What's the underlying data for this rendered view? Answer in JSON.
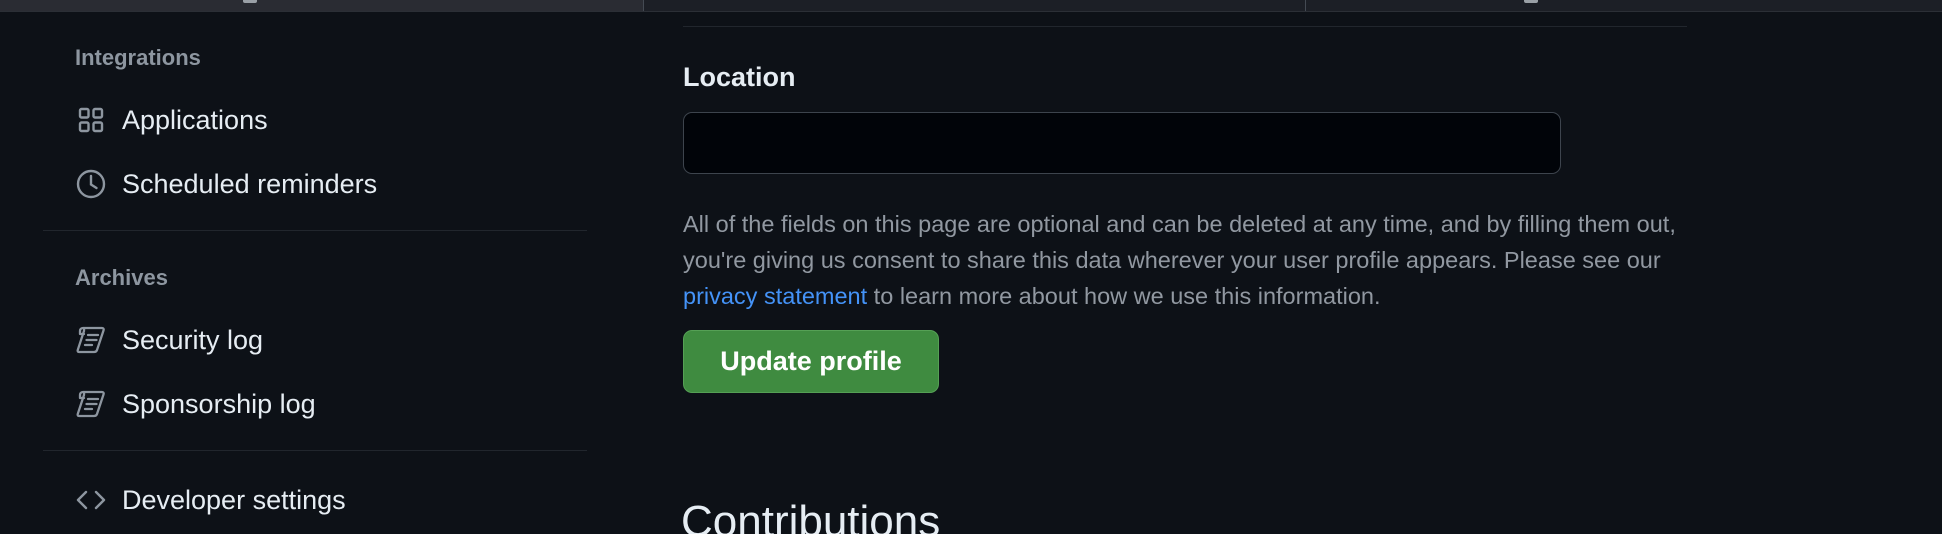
{
  "sidebar": {
    "sections": [
      {
        "title": "Integrations",
        "items": [
          {
            "label": "Applications",
            "icon": "apps-icon"
          },
          {
            "label": "Scheduled reminders",
            "icon": "clock-icon"
          }
        ]
      },
      {
        "title": "Archives",
        "items": [
          {
            "label": "Security log",
            "icon": "log-icon"
          },
          {
            "label": "Sponsorship log",
            "icon": "log-icon"
          }
        ]
      }
    ],
    "developer": {
      "label": "Developer settings",
      "icon": "code-icon"
    }
  },
  "main": {
    "location": {
      "label": "Location",
      "value": "",
      "placeholder": ""
    },
    "help": {
      "text_before": "All of the fields on this page are optional and can be deleted at any time, and by filling them out, you're giving us consent to share this data wherever your user profile appears. Please see our ",
      "link": "privacy statement",
      "text_after": " to learn more about how we use this information."
    },
    "update_button": "Update profile",
    "contributions_heading": "Contributions"
  },
  "colors": {
    "background": "#0d1117",
    "button": "#3f8b40",
    "link": "#4493f8",
    "muted_text": "#9198a1"
  }
}
